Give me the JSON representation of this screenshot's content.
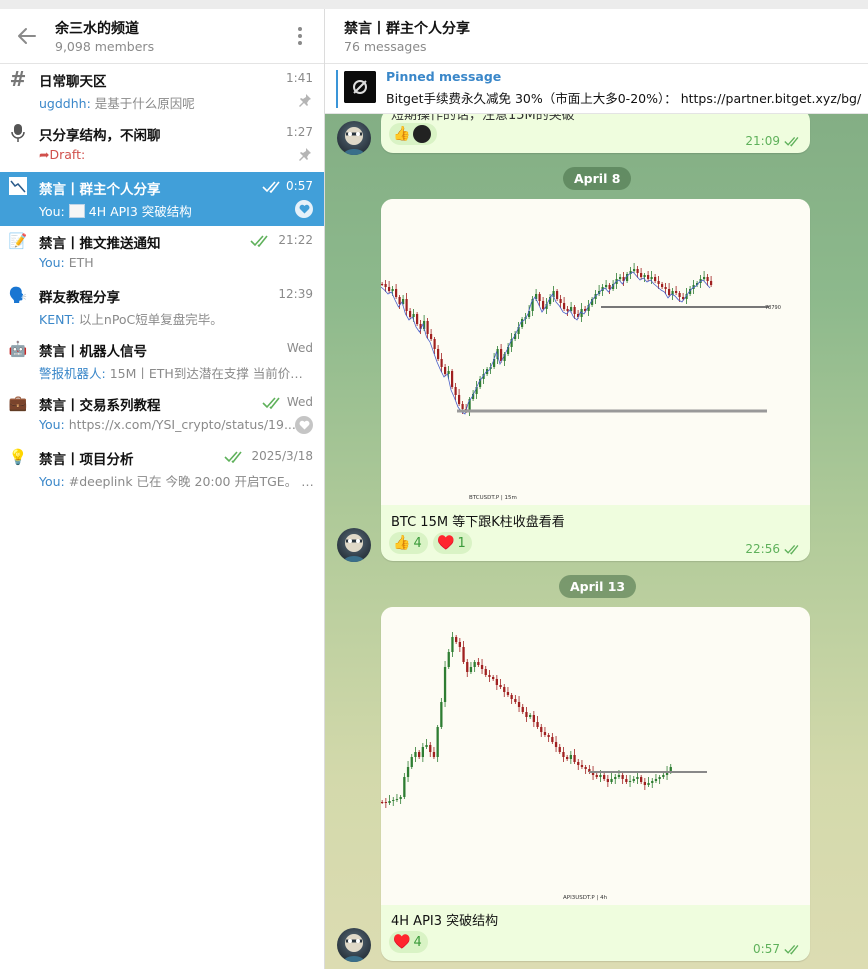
{
  "channel": {
    "title": "余三水的频道",
    "members": "9,098 members"
  },
  "chats": [
    {
      "name": "日常聊天区",
      "time": "1:41",
      "sender": "ugddhh:",
      "preview": " 是基于什么原因呢"
    },
    {
      "name": "只分享结构，不闲聊",
      "time": "1:27",
      "sender": "Draft:",
      "preview": ""
    },
    {
      "name": "禁言丨群主个人分享",
      "time": "0:57",
      "sender": "You:",
      "preview": "4H API3 突破结构"
    },
    {
      "name": "禁言丨推文推送通知",
      "time": "21:22",
      "sender": "You:",
      "preview": " ETH"
    },
    {
      "name": "群友教程分享",
      "time": "12:39",
      "sender": "KENT:",
      "preview": " 以上nPoC短单复盘完毕。"
    },
    {
      "name": "禁言丨机器人信号",
      "time": "Wed",
      "sender": "警报机器人:",
      "preview": " 15M丨ETH到达潜在支撑 当前价格..."
    },
    {
      "name": "禁言丨交易系列教程",
      "time": "Wed",
      "sender": "You:",
      "preview": " https://x.com/YSI_crypto/status/19..."
    },
    {
      "name": "禁言丨项目分析",
      "time": "2025/3/18",
      "sender": "You:",
      "preview": " #deeplink 已在 今晚 20:00 开启TGE。 已..."
    }
  ],
  "icons": [
    "hash-icon",
    "microphone-icon",
    "chart-thumb-icon",
    "memo-icon",
    "speaking-head-icon",
    "robot-icon",
    "briefcase-icon",
    "bulb-icon"
  ],
  "conversation": {
    "title": "禁言丨群主个人分享",
    "count": "76 messages",
    "pinned_title": "Pinned message",
    "pinned_text": "Bitget手续费永久减免 30%（市面上大多0-20%）：  https://partner.bitget.xyz/bg/"
  },
  "messages": [
    {
      "partial_text": "短期操作的话，注意15M的突破",
      "time": "21:09"
    },
    {
      "date": "April 8",
      "chart_label": "BTCUSDT.P | 15m",
      "price_tag": "78790",
      "caption": "BTC 15M 等下跟K柱收盘看看",
      "reactions": [
        {
          "emoji": "👍",
          "count": "4"
        },
        {
          "emoji": "♥️",
          "count": "1"
        }
      ],
      "time": "22:56"
    },
    {
      "date": "April 13",
      "chart_label": "API3USDT.P | 4h",
      "caption": "4H API3 突破结构",
      "reactions": [
        {
          "emoji": "♥️",
          "count": "4"
        }
      ],
      "time": "0:57"
    }
  ],
  "colors": {
    "accent": "#419fd9",
    "link": "#3a87c9",
    "bubble": "#effdde",
    "check": "#5fb15b"
  }
}
